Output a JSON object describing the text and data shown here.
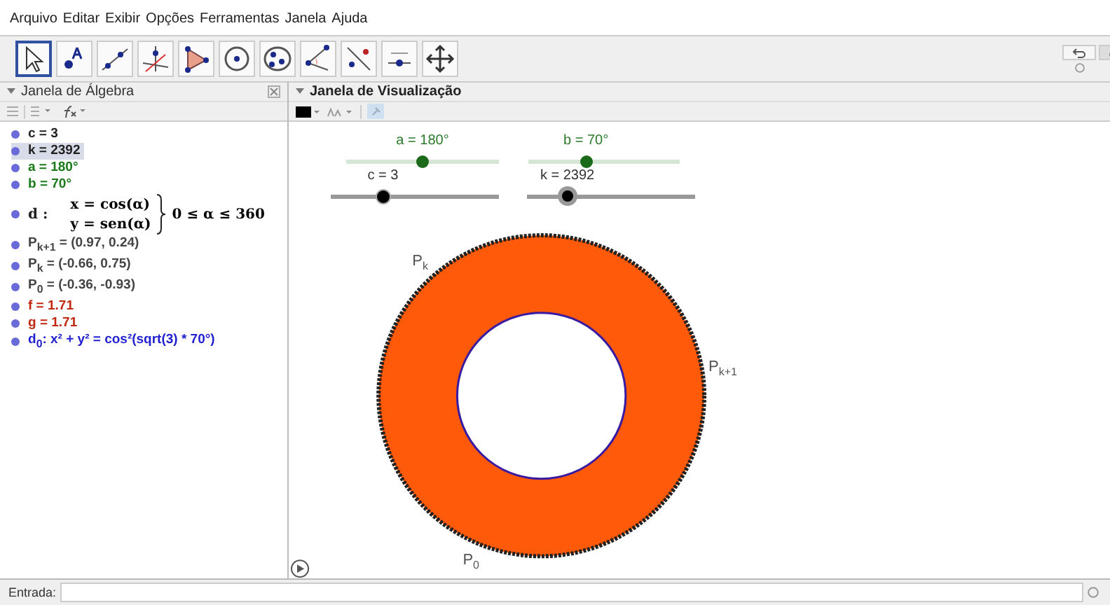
{
  "menu": [
    "Arquivo",
    "Editar",
    "Exibir",
    "Opções",
    "Ferramentas",
    "Janela",
    "Ajuda"
  ],
  "tools": [
    {
      "kind": "pointer",
      "selected": true
    },
    {
      "kind": "point",
      "selected": false
    },
    {
      "kind": "line",
      "selected": false
    },
    {
      "kind": "perpendicular",
      "selected": false
    },
    {
      "kind": "polygon",
      "selected": false
    },
    {
      "kind": "circle",
      "selected": false
    },
    {
      "kind": "conic",
      "selected": false
    },
    {
      "kind": "angle",
      "selected": false
    },
    {
      "kind": "reflect",
      "selected": false
    },
    {
      "kind": "slider",
      "selected": false
    },
    {
      "kind": "move",
      "selected": false
    }
  ],
  "algebra": {
    "title": "Janela de Álgebra",
    "items": [
      {
        "kind": "text",
        "text": "c = 3",
        "color": "#222222",
        "selected": false
      },
      {
        "kind": "text",
        "text": "k = 2392",
        "color": "#222222",
        "selected": true
      },
      {
        "kind": "text",
        "text": "a = 180°",
        "color": "#1a7a1a",
        "selected": false
      },
      {
        "kind": "text",
        "text": "b = 70°",
        "color": "#1a7a1a",
        "selected": false
      },
      {
        "kind": "parametric",
        "name": "d :",
        "x": "x = cos(α)",
        "y": "y = sen(α)",
        "condition": "0 ≤ α ≤ 360",
        "color": "#222222",
        "selected": false
      },
      {
        "kind": "text",
        "text": "P$_{k+1}$ = (0.97, 0.24)",
        "color": "#444444",
        "selected": false
      },
      {
        "kind": "text",
        "text": "P$_{k}$ = (-0.66, 0.75)",
        "color": "#444444",
        "selected": false
      },
      {
        "kind": "text",
        "text": "P$_{0}$ = (-0.36, -0.93)",
        "color": "#444444",
        "selected": false
      },
      {
        "kind": "text",
        "text": "f = 1.71",
        "color": "#c0290f",
        "selected": false
      },
      {
        "kind": "text",
        "text": "g = 1.71",
        "color": "#c0290f",
        "selected": false
      },
      {
        "kind": "text",
        "text": "d$_{0}$: x² + y² = cos²(sqrt(3) * 70°)",
        "color": "#1f1fd0",
        "selected": false
      }
    ]
  },
  "graphics": {
    "title": "Janela de Visualização",
    "sliders": [
      {
        "label": "a = 180°",
        "level": 0.5,
        "kind": "angle"
      },
      {
        "label": "b = 70°",
        "level": 0.38,
        "kind": "angle"
      },
      {
        "label": "c = 3",
        "level": 0.31,
        "kind": "number"
      },
      {
        "label": "k = 2392",
        "level": 0.24,
        "kind": "number"
      }
    ],
    "points": [
      {
        "base": "P",
        "sub": "k"
      },
      {
        "base": "P",
        "sub": "k+1"
      },
      {
        "base": "P",
        "sub": "0"
      }
    ]
  },
  "input": {
    "label": "Entrada:"
  }
}
